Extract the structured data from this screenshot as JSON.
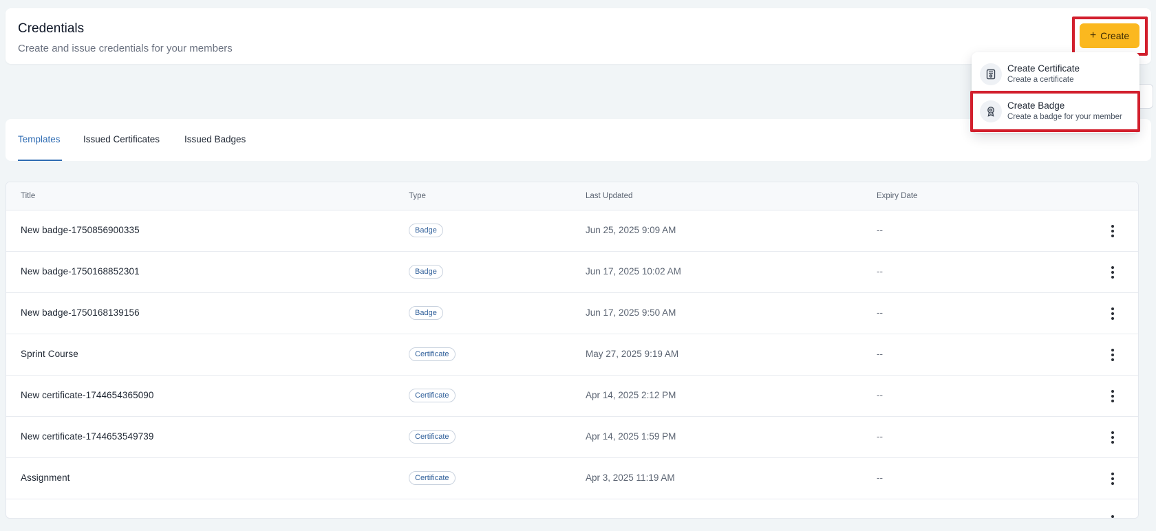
{
  "header": {
    "title": "Credentials",
    "subtitle": "Create and issue credentials for your members",
    "create_label": "Create"
  },
  "dropdown": {
    "items": [
      {
        "title": "Create Certificate",
        "desc": "Create a certificate",
        "icon": "certificate-icon"
      },
      {
        "title": "Create Badge",
        "desc": "Create a badge for your member",
        "icon": "badge-icon"
      }
    ]
  },
  "tabs": [
    {
      "label": "Templates",
      "active": true
    },
    {
      "label": "Issued Certificates",
      "active": false
    },
    {
      "label": "Issued Badges",
      "active": false
    }
  ],
  "table": {
    "columns": [
      "Title",
      "Type",
      "Last Updated",
      "Expiry Date"
    ],
    "rows": [
      {
        "title": "New badge-1750856900335",
        "type": "Badge",
        "updated": "Jun 25, 2025 9:09 AM",
        "expiry": "--"
      },
      {
        "title": "New badge-1750168852301",
        "type": "Badge",
        "updated": "Jun 17, 2025 10:02 AM",
        "expiry": "--"
      },
      {
        "title": "New badge-1750168139156",
        "type": "Badge",
        "updated": "Jun 17, 2025 9:50 AM",
        "expiry": "--"
      },
      {
        "title": "Sprint Course",
        "type": "Certificate",
        "updated": "May 27, 2025 9:19 AM",
        "expiry": "--"
      },
      {
        "title": "New certificate-1744654365090",
        "type": "Certificate",
        "updated": "Apr 14, 2025 2:12 PM",
        "expiry": "--"
      },
      {
        "title": "New certificate-1744653549739",
        "type": "Certificate",
        "updated": "Apr 14, 2025 1:59 PM",
        "expiry": "--"
      },
      {
        "title": "Assignment",
        "type": "Certificate",
        "updated": "Apr 3, 2025 11:19 AM",
        "expiry": "--"
      }
    ]
  },
  "colors": {
    "accent": "#fbb81f",
    "tab_active": "#2f6cb3",
    "highlight": "#d21f2d"
  }
}
